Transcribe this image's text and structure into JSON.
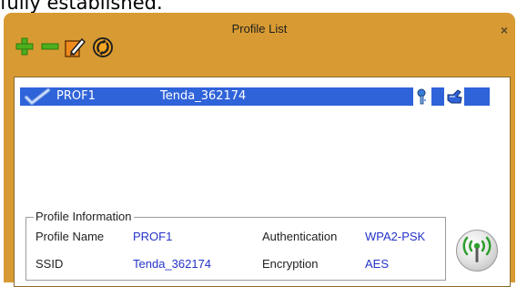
{
  "top_text": "fully established.",
  "window": {
    "title": "Profile List",
    "close_glyph": "×"
  },
  "toolbar": {
    "add_icon": "plus-icon",
    "remove_icon": "minus-icon",
    "edit_icon": "edit-icon",
    "activate_icon": "activate-icon"
  },
  "profiles": [
    {
      "name": "PROF1",
      "ssid": "Tenda_362174",
      "selected": true
    }
  ],
  "profile_information": {
    "legend": "Profile Information",
    "profile_name_label": "Profile Name",
    "profile_name_value": "PROF1",
    "ssid_label": "SSID",
    "ssid_value": "Tenda_362174",
    "authentication_label": "Authentication",
    "authentication_value": "WPA2-PSK",
    "encryption_label": "Encryption",
    "encryption_value": "AES"
  },
  "colors": {
    "panel": "#d89b33",
    "selection": "#2f63d9",
    "value_text": "#2433c8",
    "add_green": "#4caf1e",
    "edit_orange": "#f08a1c"
  }
}
